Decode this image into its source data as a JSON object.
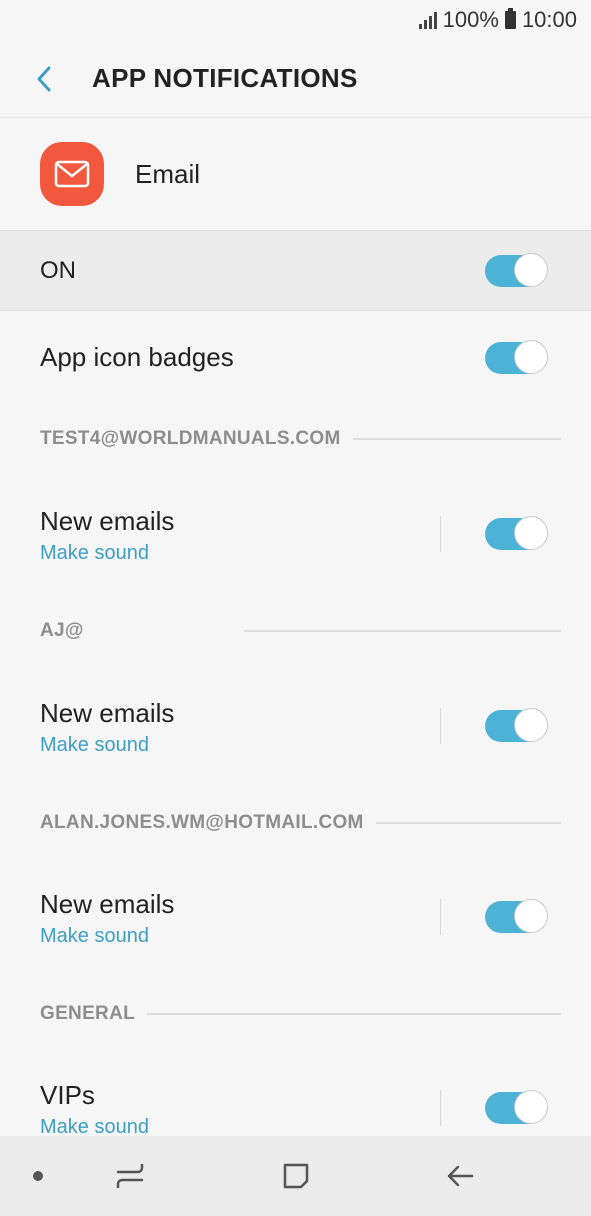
{
  "status_bar": {
    "battery": "100%",
    "time": "10:00"
  },
  "header": {
    "title": "APP NOTIFICATIONS"
  },
  "app": {
    "name": "Email"
  },
  "master": {
    "label": "ON",
    "enabled": true
  },
  "badges": {
    "label": "App icon badges",
    "enabled": true
  },
  "accounts": [
    {
      "header": "TEST4@WORLDMANUALS.COM",
      "item_label": "New emails",
      "item_sub": "Make sound",
      "enabled": true
    },
    {
      "header": "AJ@",
      "item_label": "New emails",
      "item_sub": "Make sound",
      "enabled": true
    },
    {
      "header": "ALAN.JONES.WM@HOTMAIL.COM",
      "item_label": "New emails",
      "item_sub": "Make sound",
      "enabled": true
    }
  ],
  "general": {
    "header": "GENERAL",
    "item_label": "VIPs",
    "item_sub": "Make sound",
    "enabled": true
  },
  "colors": {
    "accent": "#4cb3d6",
    "app_icon": "#f2583e",
    "sublabel": "#3d9ec4"
  }
}
